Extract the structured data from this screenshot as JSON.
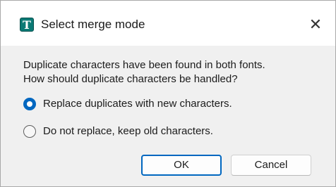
{
  "window": {
    "title": "Select merge mode",
    "app_icon_letter": "T",
    "close_glyph": "✕",
    "accent_color": "#0067c0",
    "icon_color": "#0b7a75"
  },
  "message": {
    "line1": "Duplicate characters have been found in both fonts.",
    "line2": "How should duplicate characters be handled?"
  },
  "options": [
    {
      "label": "Replace duplicates with new characters.",
      "selected": true
    },
    {
      "label": "Do not replace, keep old characters.",
      "selected": false
    }
  ],
  "buttons": {
    "ok_label": "OK",
    "cancel_label": "Cancel"
  }
}
